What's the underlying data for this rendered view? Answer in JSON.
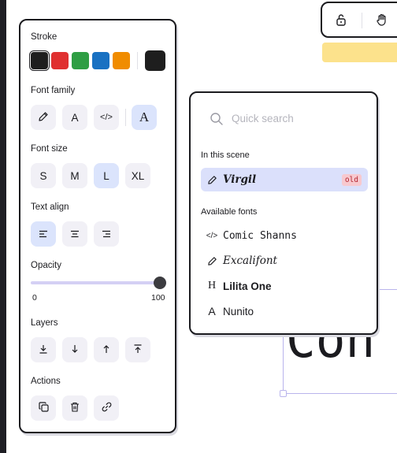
{
  "properties": {
    "stroke": {
      "label": "Stroke",
      "swatches": [
        "#1e1e1e",
        "#e03131",
        "#2f9e44",
        "#1971c2",
        "#f08c00"
      ],
      "current": "#1e1e1e"
    },
    "font_family": {
      "label": "Font family",
      "options": [
        {
          "name": "hand-drawn",
          "glyph": ""
        },
        {
          "name": "normal",
          "glyph": "A"
        },
        {
          "name": "code",
          "glyph": "</>"
        },
        {
          "name": "more",
          "glyph": "A"
        }
      ]
    },
    "font_size": {
      "label": "Font size",
      "options": [
        "S",
        "M",
        "L",
        "XL"
      ],
      "selected": "L"
    },
    "text_align": {
      "label": "Text align",
      "selected": "left"
    },
    "opacity": {
      "label": "Opacity",
      "min": "0",
      "max": "100",
      "value": 100
    },
    "layers": {
      "label": "Layers"
    },
    "actions": {
      "label": "Actions"
    }
  },
  "font_picker": {
    "search_placeholder": "Quick search",
    "scene_heading": "In this scene",
    "scene_fonts": [
      {
        "name": "Virgil",
        "badge": "old",
        "icon": "pencil-icon"
      }
    ],
    "available_heading": "Available fonts",
    "available_fonts": [
      {
        "name": "Comic Shanns",
        "icon": "code-icon"
      },
      {
        "name": "Excalifont",
        "icon": "pencil-icon"
      },
      {
        "name": "Lilita One",
        "icon": "heading-icon"
      },
      {
        "name": "Nunito",
        "icon": "letter-a-icon"
      }
    ]
  },
  "toolbar": {
    "items": [
      "lock-icon",
      "hand-icon"
    ]
  },
  "colors": {
    "accent": "#dbe4fc",
    "selected_item": "#dbe0fb",
    "hint": "#fce28c",
    "badge_bg": "#f7c9cf",
    "badge_text": "#b4232f"
  },
  "canvas": {
    "text": "Con"
  }
}
